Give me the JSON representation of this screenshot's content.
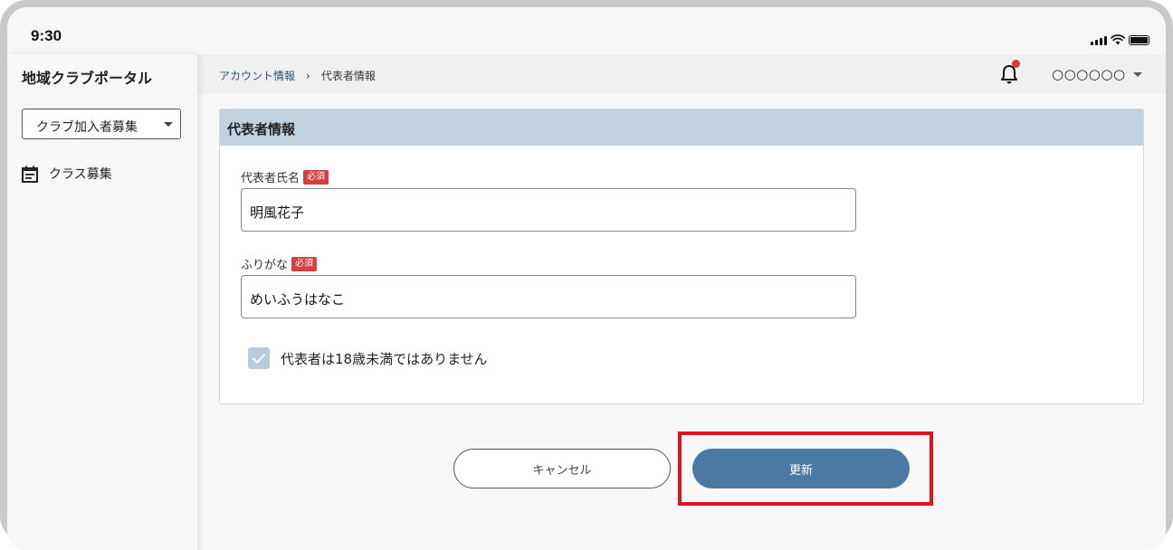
{
  "status_bar": {
    "time": "9:30"
  },
  "sidebar": {
    "app_title": "地域クラブポータル",
    "select_value": "クラブ加入者募集",
    "items": [
      {
        "label": "クラス募集",
        "icon": "calendar-icon"
      }
    ]
  },
  "header": {
    "breadcrumb": {
      "parent": "アカウント情報",
      "separator": "›",
      "current": "代表者情報"
    },
    "user_name": "○○○○○○",
    "notification_dot_color": "#d63a3a"
  },
  "card": {
    "title": "代表者情報",
    "fields": [
      {
        "label": "代表者氏名",
        "required_badge": "必須",
        "value": "明風花子"
      },
      {
        "label": "ふりがな",
        "required_badge": "必須",
        "value": "めいふうはなこ"
      }
    ],
    "checkbox_label": "代表者は18歳未満ではありません",
    "checkbox_checked": true
  },
  "actions": {
    "cancel_label": "キャンセル",
    "update_label": "更新",
    "highlight_color": "#e0141e",
    "primary_color": "#4a7aa3"
  }
}
